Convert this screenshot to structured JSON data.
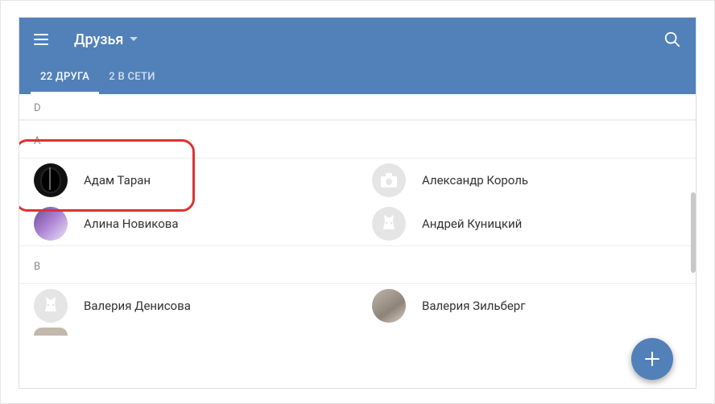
{
  "header": {
    "title": "Друзья"
  },
  "tabs": {
    "friends": "22 ДРУГА",
    "online": "2 В СЕТИ"
  },
  "sections": {
    "d": "D",
    "a": "А",
    "v": "В"
  },
  "friends": {
    "adam": "Адам Таран",
    "alex": "Александр Король",
    "alina": "Алина Новикова",
    "andrey": "Андрей Куницкий",
    "valeria_d": "Валерия Денисова",
    "valeria_z": "Валерия Зильберг"
  },
  "colors": {
    "accent": "#5181B8",
    "highlight": "#d33"
  }
}
